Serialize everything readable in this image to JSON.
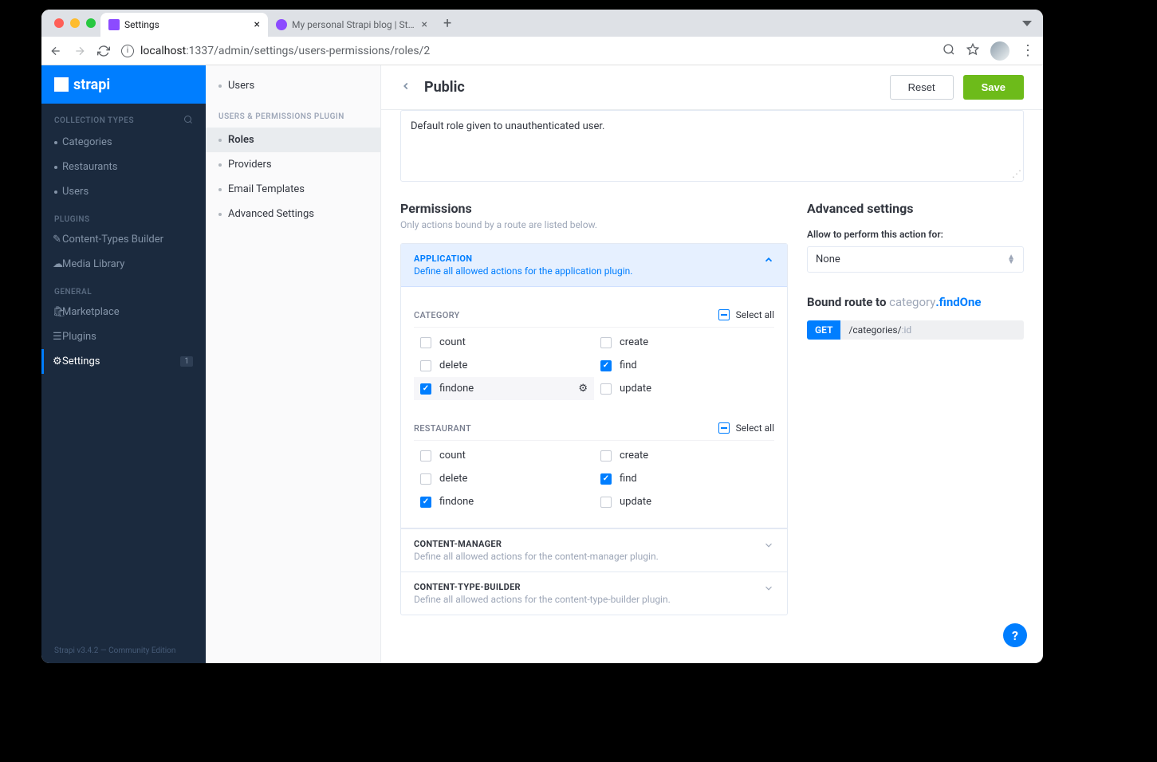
{
  "browser": {
    "tabs": [
      {
        "title": "Settings",
        "active": true
      },
      {
        "title": "My personal Strapi blog | Strap...",
        "active": false
      }
    ],
    "url_host": "localhost",
    "url_port": ":1337",
    "url_path": "/admin/settings/users-permissions/roles/2"
  },
  "brand": "strapi",
  "sidebar": {
    "section_collection": "COLLECTION TYPES",
    "collection_items": [
      "Categories",
      "Restaurants",
      "Users"
    ],
    "section_plugins": "PLUGINS",
    "plugin_items": [
      {
        "label": "Content-Types Builder",
        "icon": "✎"
      },
      {
        "label": "Media Library",
        "icon": "☁"
      }
    ],
    "section_general": "GENERAL",
    "general_items": [
      {
        "label": "Marketplace",
        "icon": "🛍",
        "badge": null
      },
      {
        "label": "Plugins",
        "icon": "≡",
        "badge": null
      },
      {
        "label": "Settings",
        "icon": "⚙",
        "badge": "1",
        "active": true
      }
    ],
    "footer": "Strapi v3.4.2 — Community Edition"
  },
  "subnav": {
    "top_items": [
      "Users"
    ],
    "section": "USERS & PERMISSIONS PLUGIN",
    "items": [
      {
        "label": "Roles",
        "active": true
      },
      {
        "label": "Providers"
      },
      {
        "label": "Email Templates"
      },
      {
        "label": "Advanced Settings"
      }
    ]
  },
  "header": {
    "title": "Public",
    "reset": "Reset",
    "save": "Save"
  },
  "description": "Default role given to unauthenticated user.",
  "permissions": {
    "title": "Permissions",
    "subtitle": "Only actions bound by a route are listed below.",
    "sections": [
      {
        "name": "APPLICATION",
        "sub": "Define all allowed actions for the application plugin.",
        "expanded": true,
        "groups": [
          {
            "name": "CATEGORY",
            "select_all": "Select all",
            "actions": [
              {
                "label": "count",
                "checked": false
              },
              {
                "label": "create",
                "checked": false
              },
              {
                "label": "delete",
                "checked": false
              },
              {
                "label": "find",
                "checked": true
              },
              {
                "label": "findone",
                "checked": true,
                "highlighted": true,
                "gear": true
              },
              {
                "label": "update",
                "checked": false
              }
            ]
          },
          {
            "name": "RESTAURANT",
            "select_all": "Select all",
            "actions": [
              {
                "label": "count",
                "checked": false
              },
              {
                "label": "create",
                "checked": false
              },
              {
                "label": "delete",
                "checked": false
              },
              {
                "label": "find",
                "checked": true
              },
              {
                "label": "findone",
                "checked": true
              },
              {
                "label": "update",
                "checked": false
              }
            ]
          }
        ]
      },
      {
        "name": "CONTENT-MANAGER",
        "sub": "Define all allowed actions for the content-manager plugin.",
        "expanded": false
      },
      {
        "name": "CONTENT-TYPE-BUILDER",
        "sub": "Define all allowed actions for the content-type-builder plugin.",
        "expanded": false
      }
    ]
  },
  "advanced": {
    "title": "Advanced settings",
    "allow_label": "Allow to perform this action for:",
    "select_value": "None",
    "bound_prefix": "Bound route to",
    "bound_model": "category",
    "bound_method": ".findOne",
    "route_method": "GET",
    "route_path": "/categories/",
    "route_param": ":id"
  }
}
